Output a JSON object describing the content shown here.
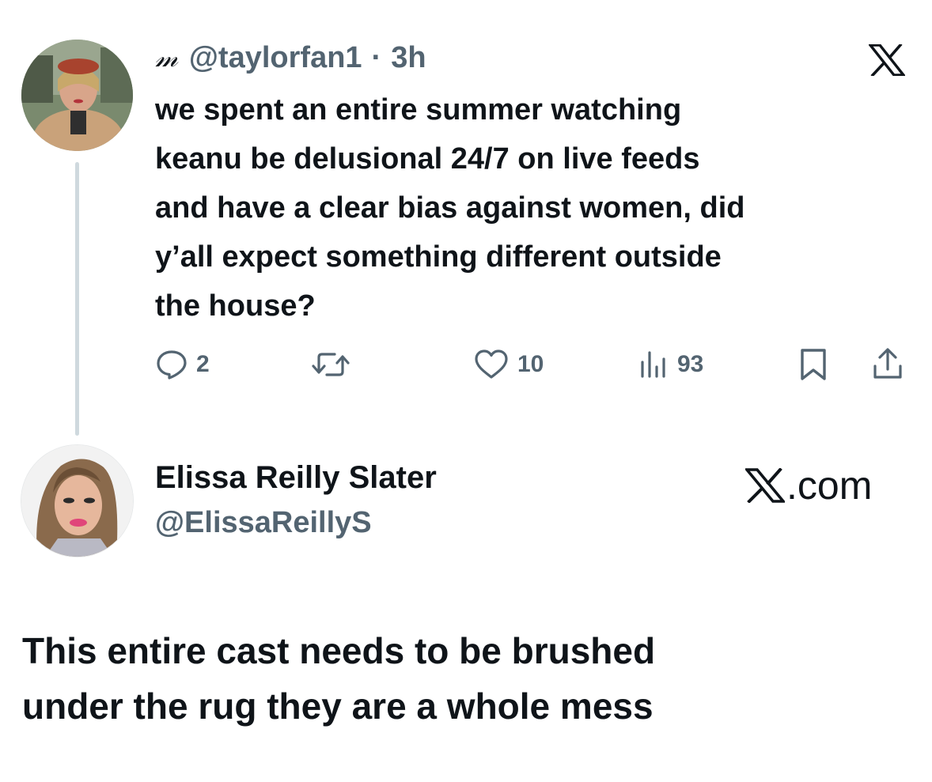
{
  "quoted_tweet": {
    "name_glyph": "𝓂",
    "handle": "@taylorfan1",
    "separator": "·",
    "time": "3h",
    "text": "we spent an entire summer watching\nkeanu be delusional 24/7 on live feeds\nand have a clear bias against women, did\ny’all expect something different outside\nthe house?",
    "actions": {
      "replies": "2",
      "retweets": "",
      "likes": "10",
      "views": "93"
    }
  },
  "author": {
    "name": "Elissa Reilly Slater",
    "handle": "@ElissaReillyS",
    "site_label": ".com"
  },
  "reply": {
    "text": "This entire cast needs to be brushed\nunder the rug they are a whole mess"
  },
  "colors": {
    "text_primary": "#0f1419",
    "text_secondary": "#536471",
    "thread_line": "#cfd9de",
    "background": "#ffffff"
  },
  "icons": {
    "top_brand": "x-logo-icon",
    "reply": "speech-bubble-icon",
    "retweet": "retweet-icon",
    "like": "heart-icon",
    "views": "bar-chart-icon",
    "bookmark": "bookmark-icon",
    "share": "share-upload-icon"
  }
}
